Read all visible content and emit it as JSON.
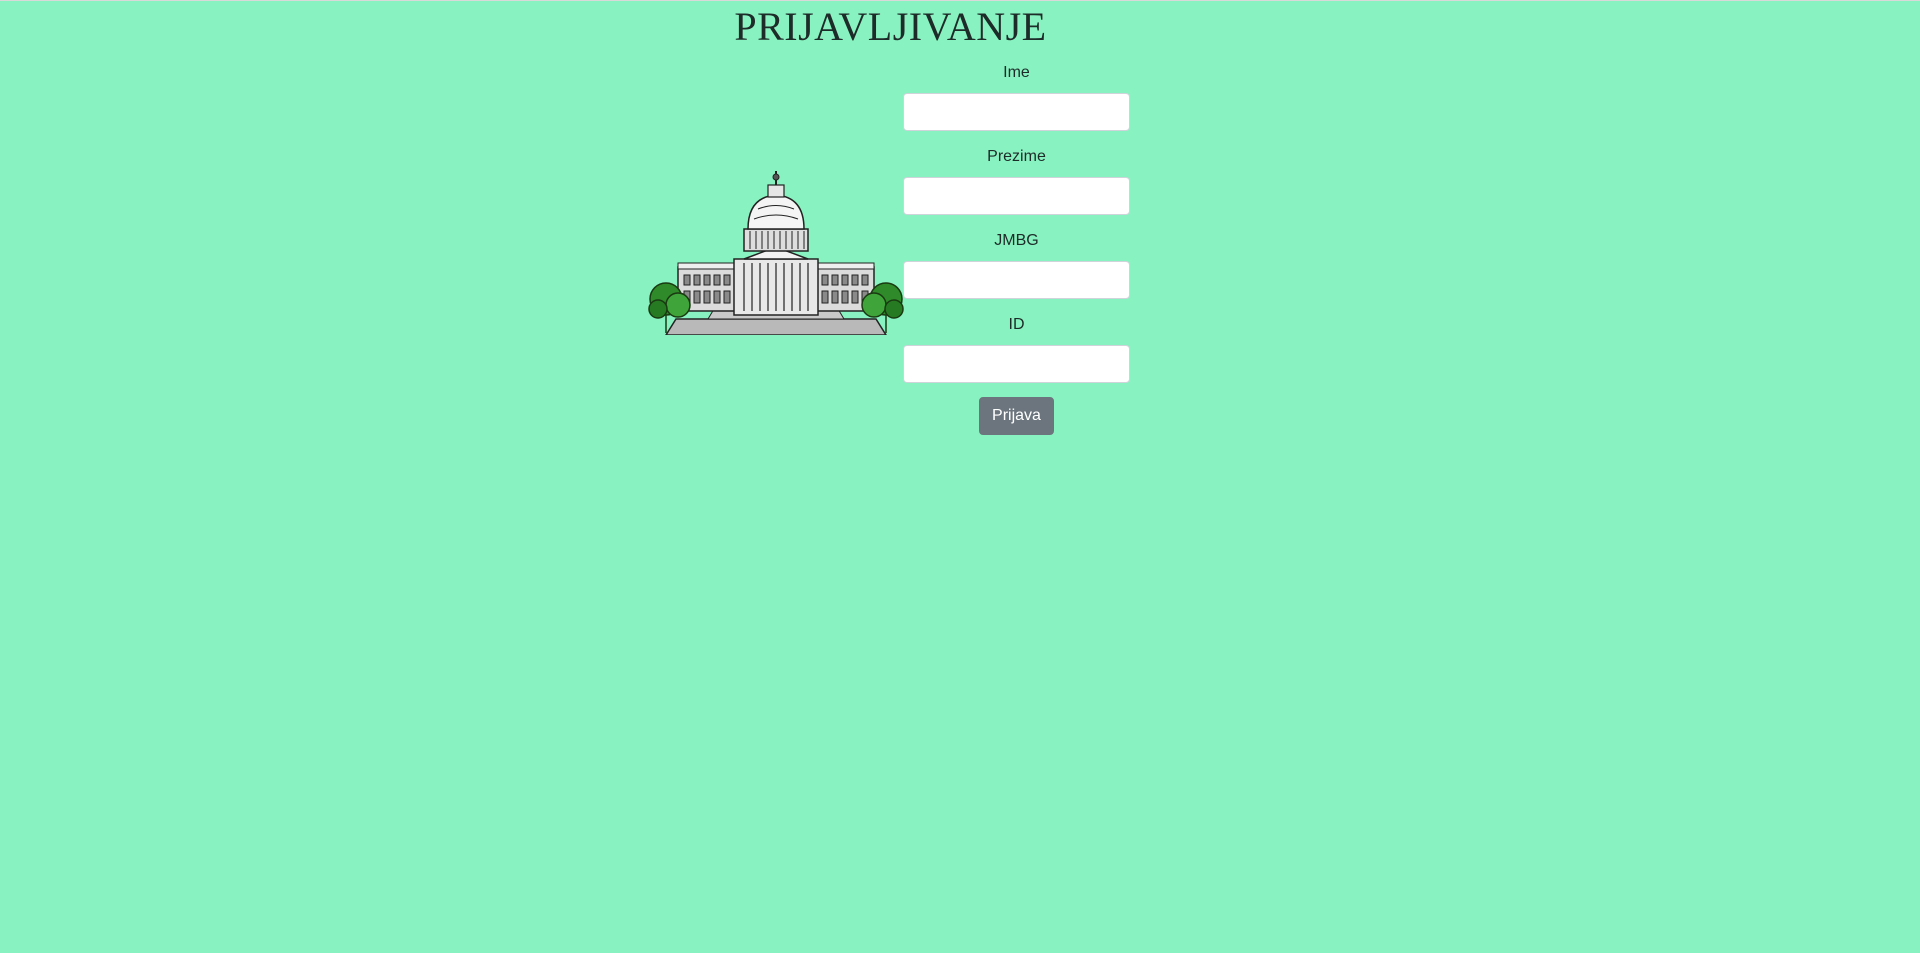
{
  "page": {
    "title": "PRIJAVLJIVANJE",
    "background_color": "#88f2c0"
  },
  "illustration": {
    "icon": "capitol-building-icon"
  },
  "form": {
    "fields": [
      {
        "label": "Ime",
        "value": "",
        "placeholder": ""
      },
      {
        "label": "Prezime",
        "value": "",
        "placeholder": ""
      },
      {
        "label": "JMBG",
        "value": "",
        "placeholder": ""
      },
      {
        "label": "ID",
        "value": "",
        "placeholder": ""
      }
    ],
    "submit_label": "Prijava",
    "submit_color": "#6c757d"
  }
}
